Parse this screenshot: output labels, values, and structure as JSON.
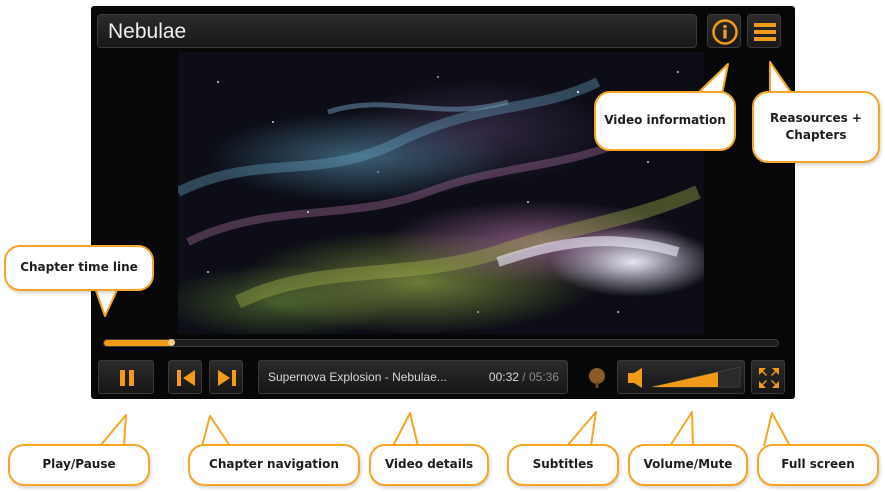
{
  "player": {
    "title": "Nebulae",
    "icons": {
      "info": "info-icon",
      "menu": "hamburger-menu-icon"
    },
    "timeline": {
      "progress_fraction": 0.1
    },
    "controls": {
      "play_pause_icon": "pause-icon",
      "prev_icon": "skip-previous-icon",
      "next_icon": "skip-next-icon",
      "subtitles_icon": "subtitles-icon",
      "volume_icon": "speaker-icon",
      "volume_level_fraction": 0.75,
      "fullscreen_icon": "fullscreen-icon"
    },
    "details": {
      "video_title": "Supernova Explosion - Nebulae...",
      "current_time": "00:32",
      "separator": "/",
      "total_time": "05:36"
    }
  },
  "callouts": {
    "video_information": "Video information",
    "resources_chapters": "Reasources + Chapters",
    "chapter_time_line": "Chapter time line",
    "play_pause": "Play/Pause",
    "chapter_navigation": "Chapter navigation",
    "video_details": "Video details",
    "subtitles": "Subtitles",
    "volume_mute": "Volume/Mute",
    "full_screen": "Full screen"
  },
  "colors": {
    "accent": "#f29a1a",
    "callout_border": "#f6a623",
    "player_bg": "#070707",
    "control_bg": "#222222"
  }
}
